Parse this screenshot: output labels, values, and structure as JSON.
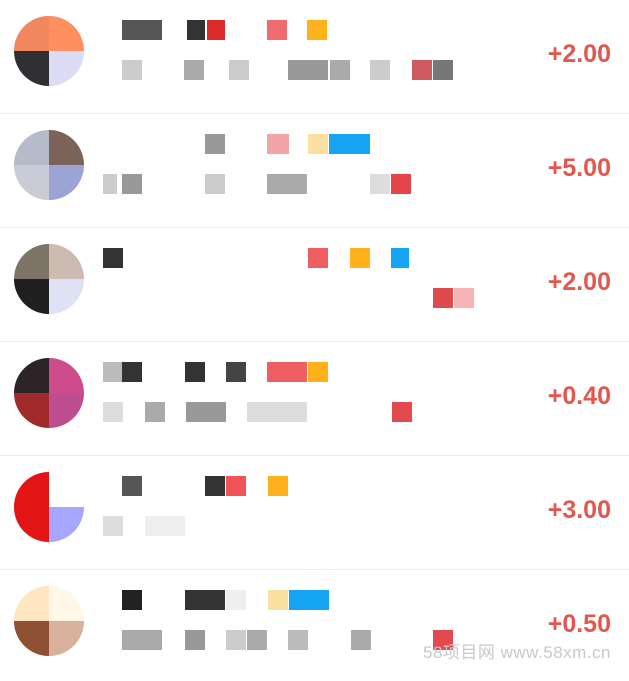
{
  "rows": [
    {
      "amount": "+2.00",
      "avatar": [
        "#f0875f",
        "#ff8f5f",
        "#2f2f34",
        "#dcdcf6"
      ],
      "line1": [
        [
          "#555555",
          22,
          40
        ],
        [
          "#333333",
          87,
          18
        ],
        [
          "#dd2a2a",
          107,
          18
        ],
        [
          "#ee6b6f",
          167,
          20
        ],
        [
          "#ffb21c",
          207,
          20
        ]
      ],
      "line2": [
        [
          "#cccccc",
          22,
          20
        ],
        [
          "#aaaaaa",
          84,
          20
        ],
        [
          "#cccccc",
          129,
          20
        ],
        [
          "#999999",
          188,
          40
        ],
        [
          "#aaaaaa",
          230,
          20
        ],
        [
          "#cccccc",
          270,
          20
        ],
        [
          "#cf5a5f",
          312,
          20
        ],
        [
          "#777777",
          333,
          20
        ]
      ]
    },
    {
      "amount": "+5.00",
      "avatar": [
        "#b5bbc8",
        "#7b6359",
        "#c9cbd6",
        "#9ba4d4"
      ],
      "line1": [
        [
          "#999999",
          105,
          20
        ],
        [
          "#f2a3a5",
          167,
          22
        ],
        [
          "#f9e0a0",
          208,
          20
        ],
        [
          "#16a5f2",
          229,
          41
        ]
      ],
      "line2": [
        [
          "#cccccc",
          3,
          14
        ],
        [
          "#999999",
          22,
          20
        ],
        [
          "#cccccc",
          105,
          20
        ],
        [
          "#aaaaaa",
          167,
          40
        ],
        [
          "#dddddd",
          270,
          20
        ],
        [
          "#e5444a",
          291,
          20
        ]
      ]
    },
    {
      "amount": "+2.00",
      "avatar": [
        "#7d7467",
        "#cdbab0",
        "#1f1f1f",
        "#dfe1f4"
      ],
      "line1": [
        [
          "#333333",
          3,
          20
        ],
        [
          "#f05d60",
          208,
          20
        ],
        [
          "#ffb21c",
          250,
          20
        ],
        [
          "#16a5f2",
          291,
          18
        ]
      ],
      "line2": [
        [
          "#dd4b4f",
          333,
          20
        ],
        [
          "#f6b3b5",
          354,
          20
        ]
      ]
    },
    {
      "amount": "+0.40",
      "avatar": [
        "#2e2326",
        "#ce4c8b",
        "#a12b2b",
        "#bd4d8f"
      ],
      "line1": [
        [
          "#bbbbbb",
          3,
          20
        ],
        [
          "#333333",
          22,
          20
        ],
        [
          "#333333",
          85,
          20
        ],
        [
          "#444444",
          126,
          20
        ],
        [
          "#ee5e62",
          167,
          40
        ],
        [
          "#ffb21c",
          208,
          20
        ]
      ],
      "line2": [
        [
          "#dddddd",
          3,
          20
        ],
        [
          "#aaaaaa",
          45,
          20
        ],
        [
          "#999999",
          86,
          40
        ],
        [
          "#dddddd",
          147,
          60
        ],
        [
          "#e24a4f",
          292,
          20
        ]
      ]
    },
    {
      "amount": "+3.00",
      "avatar": [
        "#e31414",
        "#ffffff",
        "#e31414",
        "#a6a6ff"
      ],
      "line1": [
        [
          "#555555",
          22,
          20
        ],
        [
          "#333333",
          105,
          20
        ],
        [
          "#f05358",
          126,
          20
        ],
        [
          "#ffb21c",
          168,
          20
        ]
      ],
      "line2": [
        [
          "#dddddd",
          3,
          20
        ],
        [
          "#eeeeee",
          45,
          40
        ]
      ]
    },
    {
      "amount": "+0.50",
      "avatar": [
        "#ffe5c0",
        "#fff8e8",
        "#8f4f33",
        "#d7b19c"
      ],
      "line1": [
        [
          "#222222",
          22,
          20
        ],
        [
          "#333333",
          85,
          40
        ],
        [
          "#eeeeee",
          126,
          20
        ],
        [
          "#f9e0a0",
          168,
          20
        ],
        [
          "#16a5f2",
          189,
          40
        ]
      ],
      "line2": [
        [
          "#aaaaaa",
          22,
          40
        ],
        [
          "#999999",
          85,
          20
        ],
        [
          "#cccccc",
          126,
          20
        ],
        [
          "#aaaaaa",
          147,
          20
        ],
        [
          "#bbbbbb",
          188,
          20
        ],
        [
          "#aaaaaa",
          251,
          20
        ],
        [
          "#e24a4f",
          333,
          20
        ]
      ]
    }
  ],
  "watermark": "58项目网 www.58xm.cn"
}
